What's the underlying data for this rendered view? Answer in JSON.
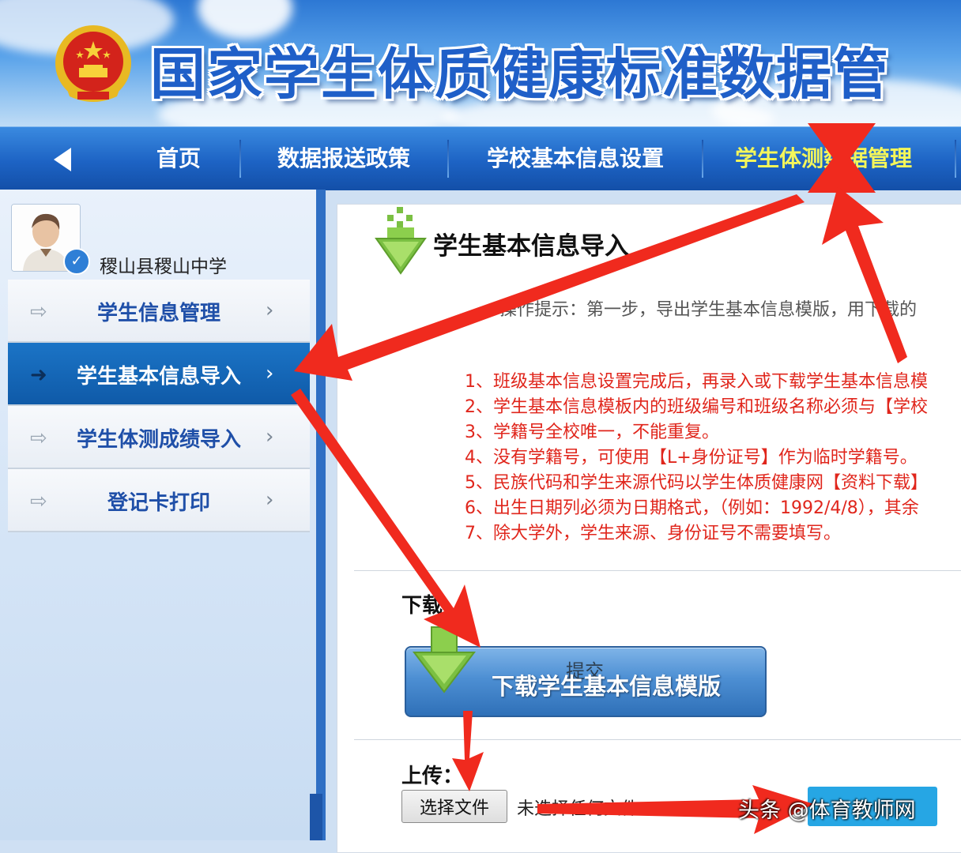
{
  "banner": {
    "title": "国家学生体质健康标准数据管"
  },
  "nav": {
    "items": [
      {
        "label": "首页"
      },
      {
        "label": "数据报送政策"
      },
      {
        "label": "学校基本信息设置"
      },
      {
        "label": "学生体测数据管理",
        "active": true
      }
    ]
  },
  "sidebar": {
    "school_name": "稷山县稷山中学",
    "menu": [
      {
        "label": "学生信息管理"
      },
      {
        "label": "学生基本信息导入",
        "active": true
      },
      {
        "label": "学生体测成绩导入"
      },
      {
        "label": "登记卡打印"
      }
    ]
  },
  "content": {
    "title": "学生基本信息导入",
    "tip": "操作提示：第一步，导出学生基本信息模版，用下载的",
    "rules": [
      "1、班级基本信息设置完成后，再录入或下载学生基本信息模",
      "2、学生基本信息模板内的班级编号和班级名称必须与【学校",
      "3、学籍号全校唯一，不能重复。",
      "4、没有学籍号，可使用【L+身份证号】作为临时学籍号。",
      "5、民族代码和学生来源代码以学生体质健康网【资料下载】",
      "6、出生日期列必须为日期格式，（例如：1992/4/8），其余",
      "7、除大学外，学生来源、身份证号不需要填写。"
    ],
    "download": {
      "label": "下载",
      "button_label": "下载学生基本信息模版",
      "overlay_text": "提交"
    },
    "upload": {
      "label": "上传：",
      "choose_file": "选择文件",
      "no_file": "未选择任何文件"
    }
  },
  "watermark": "头条 @体育教师网",
  "colors": {
    "nav_bg": "#1d63c4",
    "nav_active_text": "#f4f65a",
    "menu_active_bg": "#0f5aa8",
    "rule_text": "#e0261c",
    "arrow": "#f02a1e",
    "submit_bg": "#26a6e4"
  }
}
